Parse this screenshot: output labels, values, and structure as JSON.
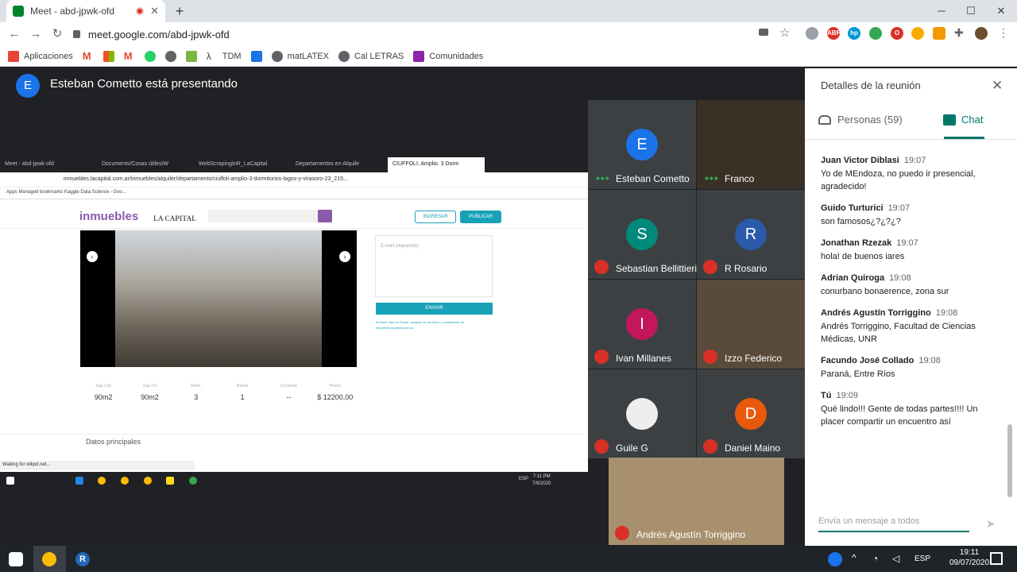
{
  "browser": {
    "tab_title": "Meet - abd-jpwk-ofd",
    "url": "meet.google.com/abd-jpwk-ofd",
    "bookmarks": [
      "Aplicaciones",
      "TDM",
      "matLATEX",
      "Cal LETRAS",
      "Comunidades"
    ]
  },
  "presenter": {
    "initial": "E",
    "text": "Esteban Cometto está presentando"
  },
  "shared": {
    "tabs": [
      "Meet - abd-jpwk-ofd",
      "Documents/Cosas útiles/W",
      "WebScrapingInR_LaCapital",
      "Departamentos en Alquile",
      "CIUFFOLI. Amplio. 3 Dorm"
    ],
    "url": "inmuebles.lacapital.com.ar/inmuebles/alquiler/departamento/ciuffoli-amplio-3-dormitorios-lagos-y-virasoro-23_215...",
    "bookmarks": "Apps   Managed bookmarks   Kaggle   Data Science - Goo...",
    "logo": "inmuebles",
    "logo2": "LA CAPITAL",
    "btn_ingresar": "INGRESAR",
    "btn_publicar": "PUBLICAR",
    "email_placeholder": "E-mail (requerido)",
    "enviar": "ENVIAR",
    "legal": "Al hacer click en Enviar, aceptas los términos y condiciones de inmuebles.lacapital.com.ar",
    "stats": [
      {
        "label": "Sup.Cub",
        "value": "90m2"
      },
      {
        "label": "Sup.Tot",
        "value": "90m2"
      },
      {
        "label": "Dorm.",
        "value": "3"
      },
      {
        "label": "Baños",
        "value": "1"
      },
      {
        "label": "Cocheras",
        "value": "--"
      },
      {
        "label": "Precio",
        "value": "$ 12200,00"
      }
    ],
    "datos": "Datos principales",
    "status": "Waiting for wikpd.net...",
    "lang": "ESP",
    "time": "7:11 PM",
    "date": "7/9/2020"
  },
  "participants": [
    {
      "name": "Esteban Cometto",
      "initial": "E",
      "color": "#1a73e8",
      "state": "speaking"
    },
    {
      "name": "Franco",
      "initial": "",
      "color": "#3a3026",
      "state": "speaking"
    },
    {
      "name": "Sebastian Bellittieri",
      "initial": "S",
      "color": "#00897b",
      "state": "muted"
    },
    {
      "name": "R Rosario",
      "initial": "R",
      "color": "#2a5aa8",
      "state": "muted"
    },
    {
      "name": "Ivan Millanes",
      "initial": "I",
      "color": "#c2185b",
      "state": "muted"
    },
    {
      "name": "Izzo Federico",
      "initial": "",
      "color": "#5a4a3a",
      "state": "muted"
    },
    {
      "name": "Guile G",
      "initial": "",
      "color": "#eeeeee",
      "state": "muted"
    },
    {
      "name": "Daniel Maino",
      "initial": "D",
      "color": "#e8590c",
      "state": "muted"
    }
  ],
  "featured": {
    "name": "Andrés Agustín Torriggino"
  },
  "panel": {
    "title": "Detalles de la reunión",
    "people_tab": "Personas (59)",
    "chat_tab": "Chat",
    "messages": [
      {
        "who": "Juan Victor Diblasi",
        "time": "19:07",
        "text": "Yo de MEndoza, no  puedo ir presencial, agradecido!"
      },
      {
        "who": "Guido Turturici",
        "time": "19:07",
        "text": "son famosos¿?¿?¿?"
      },
      {
        "who": "Jonathan Rzezak",
        "time": "19:07",
        "text": "hola! de buenos iares"
      },
      {
        "who": "Adrian Quiroga",
        "time": "19:08",
        "text": "conurbano bonaerence, zona sur"
      },
      {
        "who": "Andrés Agustín Torriggino",
        "time": "19:08",
        "text": "Andrés Torriggino, Facultad de Ciencias Médicas, UNR"
      },
      {
        "who": "Facundo José Collado",
        "time": "19:08",
        "text": "Paraná, Entre Ríos"
      },
      {
        "who": "Tú",
        "time": "19:09",
        "text": "Qué lindo!!! Gente de todas partes!!!! Un placer compartir un encuentro así"
      }
    ],
    "compose_placeholder": "Envía un mensaje a todos"
  },
  "taskbar": {
    "lang": "ESP",
    "time": "19:11",
    "date": "09/07/2020"
  }
}
